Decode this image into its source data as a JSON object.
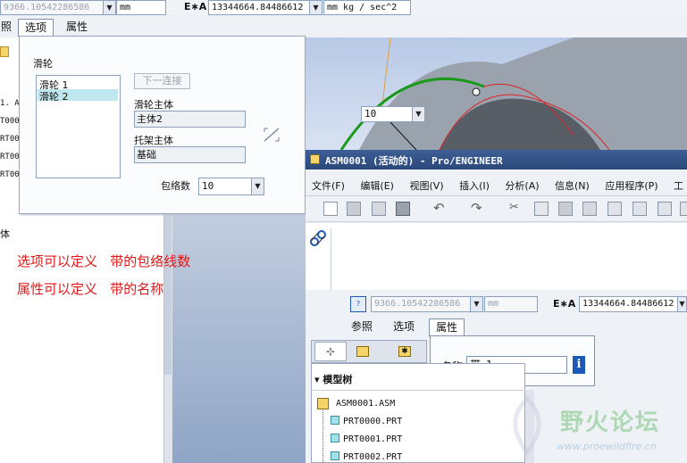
{
  "top_bar": {
    "left_value": "9366.10542286586",
    "left_unit": "mm",
    "e_label": "E∗A",
    "e_value": "13344664.84486612",
    "e_unit": "mm kg / sec^2"
  },
  "top_tabs": [
    "照",
    "选项",
    "属性"
  ],
  "options_panel": {
    "section_label": "滑轮",
    "list_items": [
      "滑轮 1",
      "滑轮 2"
    ],
    "next_button": "下一连接",
    "pulley_body_label": "滑轮主体",
    "pulley_body_value": "主体2",
    "bracket_body_label": "托架主体",
    "bracket_body_value": "基础",
    "wrap_count_label": "包络数",
    "wrap_count_value": "10"
  },
  "left_tree_fragments": [
    "1. AS",
    "T000",
    "RT00",
    "RT00",
    "RT00"
  ],
  "left_small_label": "体",
  "annotations": [
    "选项可以定义   带的包络线数",
    "属性可以定义   带的名称"
  ],
  "viewport_dropdown": "10",
  "window": {
    "title": "ASM0001 (活动的) - Pro/ENGINEER",
    "menu": [
      "文件(F)",
      "编辑(E)",
      "视图(V)",
      "插入(I)",
      "分析(A)",
      "信息(N)",
      "应用程序(P)",
      "工"
    ],
    "field_left_value": "9366.10542286586",
    "field_left_unit": "mm",
    "e_label": "E∗A",
    "e_value": "13344664.84486612",
    "tabs": [
      "参照",
      "选项",
      "属性"
    ],
    "name_label": "名称",
    "name_value": "带_1",
    "model_tree_label": "模型树",
    "tree_items": [
      "ASM0001.ASM",
      "PRT0000.PRT",
      "PRT0001.PRT",
      "PRT0002.PRT"
    ]
  },
  "watermark": {
    "title": "野火论坛",
    "url": "www.proewildfire.cn"
  },
  "colors": {
    "annotation_red": "#e01818",
    "window_title_bar": "#2f4f82",
    "belt_green": "#1a9a1a",
    "info_blue": "#1c58b8"
  }
}
